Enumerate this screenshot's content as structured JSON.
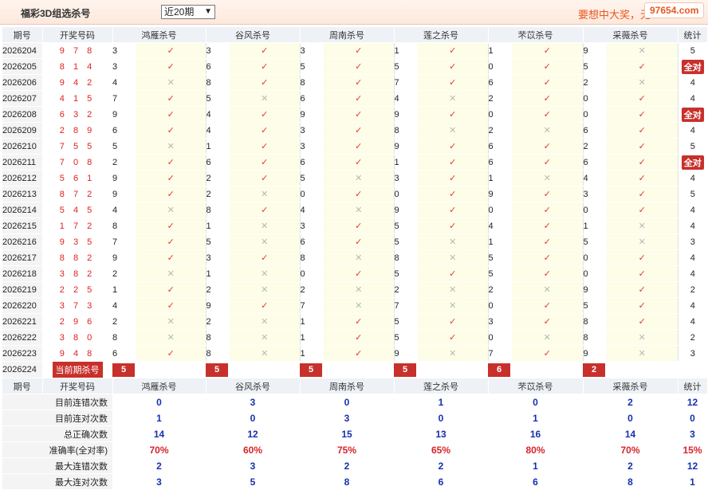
{
  "header": {
    "title": "福彩3D组选杀号",
    "period_selected": "近20期",
    "slogan": "要想中大奖，无",
    "watermark": "97654.com"
  },
  "columns": {
    "issue": "期号",
    "draw": "开奖号码",
    "experts": [
      "鸿雁杀号",
      "谷风杀号",
      "周南杀号",
      "莲之杀号",
      "芣苡杀号",
      "采薇杀号"
    ],
    "stat": "统计"
  },
  "rows": [
    {
      "issue": "2026204",
      "draw": "9 7 8",
      "kills": [
        [
          3,
          1
        ],
        [
          3,
          1
        ],
        [
          3,
          1
        ],
        [
          1,
          1
        ],
        [
          1,
          1
        ],
        [
          9,
          0
        ]
      ],
      "stat": "5",
      "all": false
    },
    {
      "issue": "2026205",
      "draw": "8 1 4",
      "kills": [
        [
          3,
          1
        ],
        [
          6,
          1
        ],
        [
          5,
          1
        ],
        [
          5,
          1
        ],
        [
          0,
          1
        ],
        [
          5,
          1
        ]
      ],
      "stat": "全对",
      "all": true
    },
    {
      "issue": "2026206",
      "draw": "9 4 2",
      "kills": [
        [
          4,
          0
        ],
        [
          8,
          1
        ],
        [
          8,
          1
        ],
        [
          7,
          1
        ],
        [
          6,
          1
        ],
        [
          2,
          0
        ]
      ],
      "stat": "4",
      "all": false
    },
    {
      "issue": "2026207",
      "draw": "4 1 5",
      "kills": [
        [
          7,
          1
        ],
        [
          5,
          0
        ],
        [
          6,
          1
        ],
        [
          4,
          0
        ],
        [
          2,
          1
        ],
        [
          0,
          1
        ]
      ],
      "stat": "4",
      "all": false
    },
    {
      "issue": "2026208",
      "draw": "6 3 2",
      "kills": [
        [
          9,
          1
        ],
        [
          4,
          1
        ],
        [
          9,
          1
        ],
        [
          9,
          1
        ],
        [
          0,
          1
        ],
        [
          0,
          1
        ]
      ],
      "stat": "全对",
      "all": true
    },
    {
      "issue": "2026209",
      "draw": "2 8 9",
      "kills": [
        [
          6,
          1
        ],
        [
          4,
          1
        ],
        [
          3,
          1
        ],
        [
          8,
          0
        ],
        [
          2,
          0
        ],
        [
          6,
          1
        ]
      ],
      "stat": "4",
      "all": false
    },
    {
      "issue": "2026210",
      "draw": "7 5 5",
      "kills": [
        [
          5,
          0
        ],
        [
          1,
          1
        ],
        [
          3,
          1
        ],
        [
          9,
          1
        ],
        [
          6,
          1
        ],
        [
          2,
          1
        ]
      ],
      "stat": "5",
      "all": false
    },
    {
      "issue": "2026211",
      "draw": "7 0 8",
      "kills": [
        [
          2,
          1
        ],
        [
          6,
          1
        ],
        [
          6,
          1
        ],
        [
          1,
          1
        ],
        [
          6,
          1
        ],
        [
          6,
          1
        ]
      ],
      "stat": "全对",
      "all": true
    },
    {
      "issue": "2026212",
      "draw": "5 6 1",
      "kills": [
        [
          9,
          1
        ],
        [
          2,
          1
        ],
        [
          5,
          0
        ],
        [
          3,
          1
        ],
        [
          1,
          0
        ],
        [
          4,
          1
        ]
      ],
      "stat": "4",
      "all": false
    },
    {
      "issue": "2026213",
      "draw": "8 7 2",
      "kills": [
        [
          9,
          1
        ],
        [
          2,
          0
        ],
        [
          0,
          1
        ],
        [
          0,
          1
        ],
        [
          9,
          1
        ],
        [
          3,
          1
        ]
      ],
      "stat": "5",
      "all": false
    },
    {
      "issue": "2026214",
      "draw": "5 4 5",
      "kills": [
        [
          4,
          0
        ],
        [
          8,
          1
        ],
        [
          4,
          0
        ],
        [
          9,
          1
        ],
        [
          0,
          1
        ],
        [
          0,
          1
        ]
      ],
      "stat": "4",
      "all": false
    },
    {
      "issue": "2026215",
      "draw": "1 7 2",
      "kills": [
        [
          8,
          1
        ],
        [
          1,
          0
        ],
        [
          3,
          1
        ],
        [
          5,
          1
        ],
        [
          4,
          1
        ],
        [
          1,
          0
        ]
      ],
      "stat": "4",
      "all": false
    },
    {
      "issue": "2026216",
      "draw": "9 3 5",
      "kills": [
        [
          7,
          1
        ],
        [
          5,
          0
        ],
        [
          6,
          1
        ],
        [
          5,
          0
        ],
        [
          1,
          1
        ],
        [
          5,
          0
        ]
      ],
      "stat": "3",
      "all": false
    },
    {
      "issue": "2026217",
      "draw": "8 8 2",
      "kills": [
        [
          9,
          1
        ],
        [
          3,
          1
        ],
        [
          8,
          0
        ],
        [
          8,
          0
        ],
        [
          5,
          1
        ],
        [
          0,
          1
        ]
      ],
      "stat": "4",
      "all": false
    },
    {
      "issue": "2026218",
      "draw": "3 8 2",
      "kills": [
        [
          2,
          0
        ],
        [
          1,
          0
        ],
        [
          0,
          1
        ],
        [
          5,
          1
        ],
        [
          5,
          1
        ],
        [
          0,
          1
        ]
      ],
      "stat": "4",
      "all": false
    },
    {
      "issue": "2026219",
      "draw": "2 2 5",
      "kills": [
        [
          1,
          1
        ],
        [
          2,
          0
        ],
        [
          2,
          0
        ],
        [
          2,
          0
        ],
        [
          2,
          0
        ],
        [
          9,
          1
        ]
      ],
      "stat": "2",
      "all": false
    },
    {
      "issue": "2026220",
      "draw": "3 7 3",
      "kills": [
        [
          4,
          1
        ],
        [
          9,
          1
        ],
        [
          7,
          0
        ],
        [
          7,
          0
        ],
        [
          0,
          1
        ],
        [
          5,
          1
        ]
      ],
      "stat": "4",
      "all": false
    },
    {
      "issue": "2026221",
      "draw": "2 9 6",
      "kills": [
        [
          2,
          0
        ],
        [
          2,
          0
        ],
        [
          1,
          1
        ],
        [
          5,
          1
        ],
        [
          3,
          1
        ],
        [
          8,
          1
        ]
      ],
      "stat": "4",
      "all": false
    },
    {
      "issue": "2026222",
      "draw": "3 8 0",
      "kills": [
        [
          8,
          0
        ],
        [
          8,
          0
        ],
        [
          1,
          1
        ],
        [
          5,
          1
        ],
        [
          0,
          0
        ],
        [
          8,
          0
        ]
      ],
      "stat": "2",
      "all": false
    },
    {
      "issue": "2026223",
      "draw": "9 4 8",
      "kills": [
        [
          6,
          1
        ],
        [
          8,
          0
        ],
        [
          1,
          1
        ],
        [
          9,
          0
        ],
        [
          7,
          1
        ],
        [
          9,
          0
        ]
      ],
      "stat": "3",
      "all": false
    }
  ],
  "current": {
    "issue": "2026224",
    "label": "当前期杀号",
    "kills": [
      "5",
      "5",
      "5",
      "5",
      "6",
      "2"
    ]
  },
  "summary": {
    "header": {
      "issue": "期号",
      "draw": "开奖号码",
      "experts": [
        "鸿雁杀号",
        "谷风杀号",
        "周南杀号",
        "莲之杀号",
        "芣苡杀号",
        "采薇杀号"
      ],
      "stat": "统计"
    },
    "rows": [
      {
        "label": "目前连错次数",
        "values": [
          "0",
          "3",
          "0",
          "1",
          "0",
          "2"
        ],
        "total": "12",
        "pct": false
      },
      {
        "label": "目前连对次数",
        "values": [
          "1",
          "0",
          "3",
          "0",
          "1",
          "0"
        ],
        "total": "0",
        "pct": false
      },
      {
        "label": "总正确次数",
        "values": [
          "14",
          "12",
          "15",
          "13",
          "16",
          "14"
        ],
        "total": "3",
        "pct": false
      },
      {
        "label": "准确率(全对率)",
        "values": [
          "70%",
          "60%",
          "75%",
          "65%",
          "80%",
          "70%"
        ],
        "total": "15%",
        "pct": true
      },
      {
        "label": "最大连错次数",
        "values": [
          "2",
          "3",
          "2",
          "2",
          "1",
          "2"
        ],
        "total": "12",
        "pct": false
      },
      {
        "label": "最大连对次数",
        "values": [
          "3",
          "5",
          "8",
          "6",
          "6",
          "8"
        ],
        "total": "1",
        "pct": false
      }
    ]
  },
  "icons": {
    "correct": "check-icon",
    "wrong": "cross-icon"
  },
  "colors": {
    "accent": "#c8302c",
    "correct": "#e0373a",
    "wrong": "#b8b8b8",
    "summary_value": "#1630b0",
    "pct": "#d8232a"
  }
}
